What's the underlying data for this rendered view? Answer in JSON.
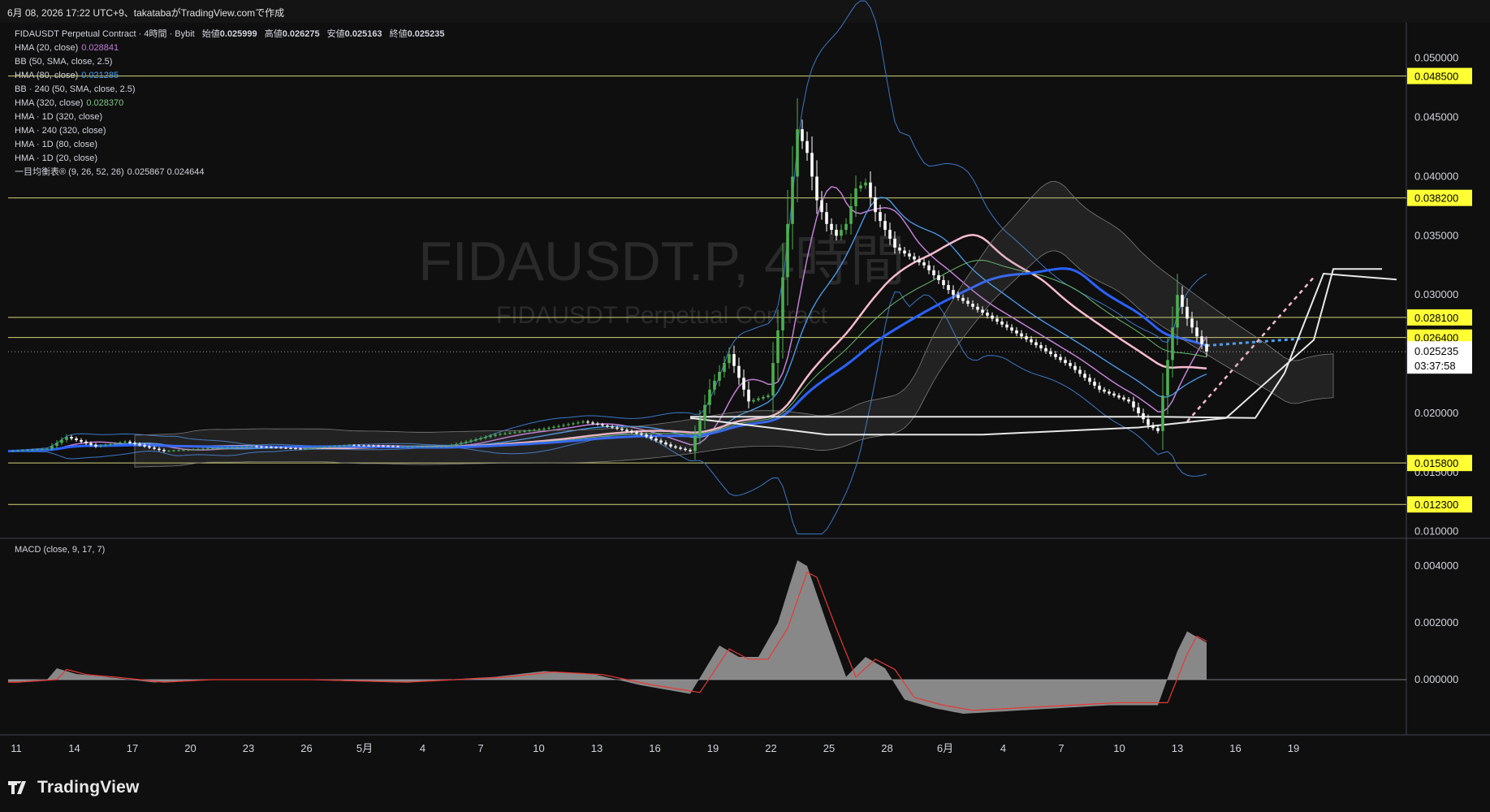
{
  "header": {
    "created_text": "6月 08, 2026 17:22 UTC+9、takatabaがTradingView.comで作成"
  },
  "watermark": {
    "main": "FIDAUSDT.P, 4時間",
    "sub": "FIDAUSDT Perpetual Contract"
  },
  "legend": {
    "title": "FIDAUSDT Perpetual Contract · 4時間 · Bybit",
    "open_label": "始値",
    "open": "0.025999",
    "high_label": "高値",
    "high": "0.026275",
    "low_label": "安値",
    "low": "0.025163",
    "close_label": "終値",
    "close": "0.025235",
    "indicators": [
      {
        "label": "HMA (20, close)",
        "value": "0.028841",
        "color": "#c27fd8"
      },
      {
        "label": "BB (50, SMA, close, 2.5)",
        "value": "",
        "color": "#d1d4dc"
      },
      {
        "label": "HMA (80, close)",
        "value": "0.021285",
        "color": "#4a9ff5"
      },
      {
        "label": "BB · 240 (50, SMA, close, 2.5)",
        "value": "",
        "color": "#d1d4dc"
      },
      {
        "label": "HMA (320, close)",
        "value": "0.028370",
        "color": "#81c784"
      },
      {
        "label": "HMA · 1D (320, close)",
        "value": "",
        "color": "#d1d4dc"
      },
      {
        "label": "HMA · 240 (320, close)",
        "value": "",
        "color": "#d1d4dc"
      },
      {
        "label": "HMA · 1D (80, close)",
        "value": "",
        "color": "#d1d4dc"
      },
      {
        "label": "HMA · 1D (20, close)",
        "value": "",
        "color": "#d1d4dc"
      },
      {
        "label": "一目均衡表® (9, 26, 52, 26)",
        "value": "0.025867  0.024644",
        "color": "#d1d4dc"
      }
    ]
  },
  "macd_legend": "MACD (close, 9, 17, 7)",
  "price_axis": {
    "ticks": [
      "0.050000",
      "0.045000",
      "0.040000",
      "0.035000",
      "0.030000",
      "0.020000",
      "0.015000",
      "0.010000"
    ],
    "last_price": "0.025235",
    "countdown": "03:37:58"
  },
  "macd_axis": {
    "ticks": [
      "0.004000",
      "0.002000",
      "0.000000"
    ]
  },
  "time_axis": {
    "labels": [
      "11",
      "14",
      "17",
      "20",
      "23",
      "26",
      "5月",
      "4",
      "7",
      "10",
      "13",
      "16",
      "19",
      "22",
      "25",
      "28",
      "6月",
      "4",
      "7",
      "10",
      "13",
      "16",
      "19"
    ]
  },
  "brand": {
    "name": "TradingView"
  },
  "colors": {
    "background": "#0f0f0f",
    "up_candle": "#4caf50",
    "down_candle": "#ffffff",
    "level_line": "#d4d47a",
    "level_label_bg": "#ffff33",
    "hma20": "#f8bbd0",
    "hma80_blue": "#4a9ff5",
    "hma320": "#2962ff",
    "hma_green": "#66bb6a",
    "bb": "#3a78c8",
    "macd_hist": "#9e9e9e",
    "macd_signal": "#e53935"
  },
  "chart_data": {
    "type": "candlestick",
    "symbol": "FIDAUSDT.P",
    "timeframe": "4時間",
    "exchange": "Bybit",
    "ylim": [
      0.0095,
      0.053
    ],
    "horizontal_levels": [
      {
        "price": 0.0485,
        "label": "0.048500"
      },
      {
        "price": 0.0382,
        "label": "0.038200"
      },
      {
        "price": 0.0281,
        "label": "0.028100"
      },
      {
        "price": 0.0264,
        "label": "0.026400"
      },
      {
        "price": 0.0158,
        "label": "0.015800"
      },
      {
        "price": 0.0123,
        "label": "0.012300"
      }
    ],
    "price_path": [
      [
        0,
        0.0168
      ],
      [
        8,
        0.017
      ],
      [
        12,
        0.018
      ],
      [
        18,
        0.0172
      ],
      [
        24,
        0.0176
      ],
      [
        32,
        0.0168
      ],
      [
        40,
        0.017
      ],
      [
        50,
        0.0172
      ],
      [
        60,
        0.017
      ],
      [
        70,
        0.0173
      ],
      [
        80,
        0.0172
      ],
      [
        90,
        0.0172
      ],
      [
        100,
        0.0182
      ],
      [
        110,
        0.0187
      ],
      [
        118,
        0.0193
      ],
      [
        124,
        0.0188
      ],
      [
        130,
        0.0182
      ],
      [
        136,
        0.0172
      ],
      [
        140,
        0.0168
      ],
      [
        144,
        0.022
      ],
      [
        148,
        0.025
      ],
      [
        152,
        0.021
      ],
      [
        156,
        0.0215
      ],
      [
        158,
        0.027
      ],
      [
        160,
        0.036
      ],
      [
        162,
        0.044
      ],
      [
        164,
        0.042
      ],
      [
        166,
        0.038
      ],
      [
        168,
        0.036
      ],
      [
        170,
        0.035
      ],
      [
        172,
        0.036
      ],
      [
        174,
        0.039
      ],
      [
        176,
        0.0395
      ],
      [
        178,
        0.037
      ],
      [
        182,
        0.034
      ],
      [
        188,
        0.0325
      ],
      [
        194,
        0.03
      ],
      [
        200,
        0.0285
      ],
      [
        206,
        0.027
      ],
      [
        212,
        0.0255
      ],
      [
        218,
        0.024
      ],
      [
        224,
        0.022
      ],
      [
        230,
        0.021
      ],
      [
        234,
        0.019
      ],
      [
        236,
        0.0185
      ],
      [
        238,
        0.0245
      ],
      [
        240,
        0.03
      ],
      [
        242,
        0.028
      ],
      [
        244,
        0.0265
      ],
      [
        246,
        0.0252
      ]
    ],
    "macd": {
      "hist": [
        [
          0,
          -0.0001
        ],
        [
          8,
          0.0
        ],
        [
          10,
          0.0004
        ],
        [
          14,
          0.0002
        ],
        [
          20,
          0.0001
        ],
        [
          30,
          -0.0001
        ],
        [
          40,
          0.0
        ],
        [
          60,
          0.0
        ],
        [
          80,
          -0.0001
        ],
        [
          100,
          0.0001
        ],
        [
          110,
          0.0003
        ],
        [
          120,
          0.0002
        ],
        [
          130,
          -0.0002
        ],
        [
          140,
          -0.0005
        ],
        [
          146,
          0.0012
        ],
        [
          150,
          0.0008
        ],
        [
          154,
          0.0008
        ],
        [
          158,
          0.002
        ],
        [
          162,
          0.0042
        ],
        [
          164,
          0.004
        ],
        [
          168,
          0.002
        ],
        [
          172,
          0.0001
        ],
        [
          176,
          0.0008
        ],
        [
          180,
          0.0004
        ],
        [
          184,
          -0.0007
        ],
        [
          190,
          -0.001
        ],
        [
          196,
          -0.0012
        ],
        [
          206,
          -0.0011
        ],
        [
          216,
          -0.001
        ],
        [
          226,
          -0.0009
        ],
        [
          232,
          -0.0009
        ],
        [
          236,
          -0.0009
        ],
        [
          240,
          0.001
        ],
        [
          242,
          0.0017
        ],
        [
          246,
          0.0013
        ]
      ]
    }
  }
}
